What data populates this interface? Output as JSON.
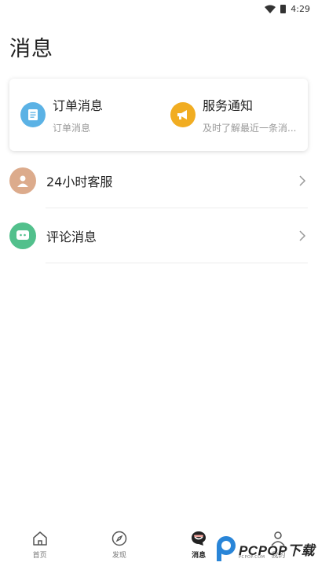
{
  "status_bar": {
    "time": "4:29"
  },
  "page": {
    "title": "消息"
  },
  "notify_card": {
    "items": [
      {
        "title": "订单消息",
        "subtitle": "订单消息",
        "icon": "order-document-icon",
        "color": "#5bb2e5"
      },
      {
        "title": "服务通知",
        "subtitle": "及时了解最近一条消...",
        "icon": "megaphone-icon",
        "color": "#f1ad22"
      }
    ]
  },
  "list": {
    "items": [
      {
        "label": "24小时客服",
        "icon": "customer-service-avatar-icon",
        "color": "#dcab8c"
      },
      {
        "label": "评论消息",
        "icon": "comment-bubble-icon",
        "color": "#52c08c"
      }
    ]
  },
  "bottom_nav": {
    "items": [
      {
        "label": "首页",
        "icon": "home-icon",
        "active": false
      },
      {
        "label": "发现",
        "icon": "compass-icon",
        "active": false
      },
      {
        "label": "消息",
        "icon": "message-icon",
        "active": true
      },
      {
        "label": "我的",
        "icon": "user-icon",
        "active": false
      }
    ]
  },
  "watermark": {
    "text": "PCPOP下载",
    "sub": "PCPOP.COM"
  }
}
